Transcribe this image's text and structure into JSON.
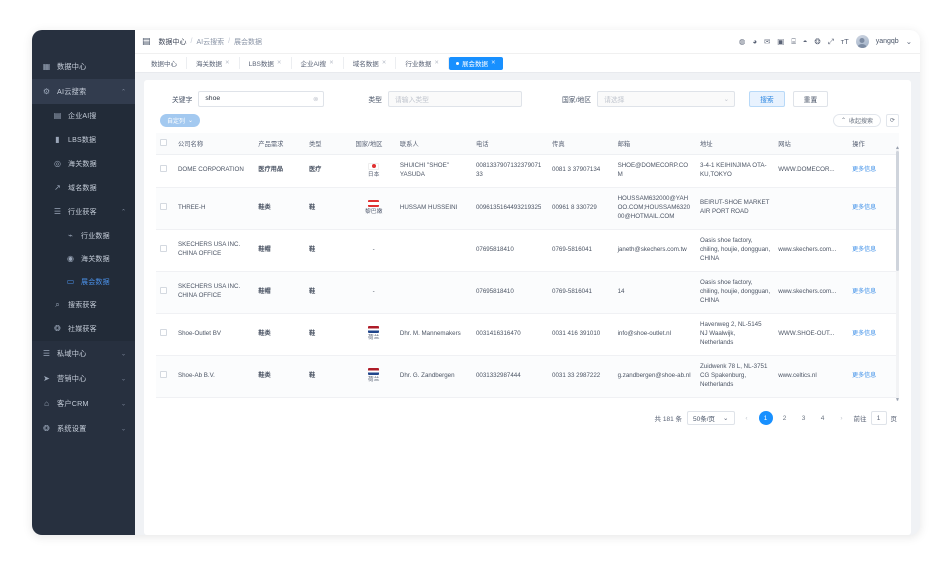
{
  "sidebar": {
    "items": [
      {
        "label": "数据中心",
        "icon": "grid-icon",
        "caret": ""
      },
      {
        "label": "AI云搜索",
        "icon": "gear-icon",
        "caret": "⌃"
      }
    ],
    "ai_children": [
      {
        "label": "企业AI搜",
        "icon": "building-icon"
      },
      {
        "label": "LBS数据",
        "icon": "book-icon"
      },
      {
        "label": "海关数据",
        "icon": "customs-icon"
      },
      {
        "label": "域名数据",
        "icon": "external-link-icon"
      }
    ],
    "industry": {
      "label": "行业获客",
      "icon": "list-icon",
      "caret": "⌃"
    },
    "industry_children": [
      {
        "label": "行业数据",
        "icon": "link-icon",
        "active": false
      },
      {
        "label": "海关数据",
        "icon": "target-icon",
        "active": false
      },
      {
        "label": "展会数据",
        "icon": "monitor-icon",
        "active": true
      }
    ],
    "after_industry": [
      {
        "label": "搜索获客",
        "icon": "search-icon"
      },
      {
        "label": "社媒获客",
        "icon": "globe-icon"
      }
    ],
    "bottom": [
      {
        "label": "私域中心",
        "icon": "layers-icon",
        "caret": "⌄"
      },
      {
        "label": "营销中心",
        "icon": "send-icon",
        "caret": "⌄"
      },
      {
        "label": "客户CRM",
        "icon": "car-icon",
        "caret": "⌄"
      },
      {
        "label": "系统设置",
        "icon": "globe-icon",
        "caret": "⌄"
      }
    ]
  },
  "topbar": {
    "hamburger": "menu-icon",
    "breadcrumb": [
      "数据中心",
      "AI云搜索",
      "展会数据"
    ],
    "icons": [
      "compass-icon",
      "message-icon",
      "mail-icon",
      "camera-icon",
      "screen-icon",
      "help-icon",
      "language-icon",
      "fullscreen-icon",
      "font-size-icon"
    ],
    "username": "yangqb",
    "user_caret": "⌄"
  },
  "tabs": [
    {
      "label": "数据中心",
      "closable": false,
      "active": false
    },
    {
      "label": "海关数据",
      "closable": true,
      "active": false
    },
    {
      "label": "LBS数据",
      "closable": true,
      "active": false
    },
    {
      "label": "企业AI搜",
      "closable": true,
      "active": false
    },
    {
      "label": "域名数据",
      "closable": true,
      "active": false
    },
    {
      "label": "行业数据",
      "closable": true,
      "active": false
    },
    {
      "label": "展会数据",
      "closable": true,
      "active": true
    }
  ],
  "filters": {
    "keyword_label": "关键字",
    "keyword_value": "shoe",
    "type_label": "类型",
    "type_placeholder": "请输入类型",
    "country_label": "国家/地区",
    "country_placeholder": "请选择",
    "search_button": "搜索",
    "reset_button": "重置",
    "column_button": "自定列",
    "column_caret": "⌄",
    "collapse_button": "收起搜索",
    "collapse_caret": "⌃",
    "refresh_icon": "refresh-icon"
  },
  "table": {
    "columns": [
      "公司名称",
      "产品需求",
      "类型",
      "国家/地区",
      "联系人",
      "电话",
      "传真",
      "邮箱",
      "地址",
      "网站",
      "操作"
    ],
    "action_label": "更多信息",
    "rows": [
      {
        "company": "DOME CORPORATION",
        "product": "医疗用品",
        "type": "医疗",
        "country": "日本",
        "flag": "#e03131",
        "contact": "SHUICHI \"SHOE\" YASUDA",
        "phone": "008133790713237907133",
        "fax": "0081 3 37907134",
        "email": "SHOE@DOMECORP.COM",
        "address": "3-4-1 KEIHINJIMA OTA-KU,TOKYO",
        "website": "WWW.DOMECOR..."
      },
      {
        "company": "THREE-H",
        "product": "鞋类",
        "type": "鞋",
        "country": "黎巴嫩",
        "flag": "#e03131",
        "contact": "HUSSAM HUSSEINI",
        "phone": "0096135164493219325",
        "fax": "00961 8 330729",
        "email": "HOUSSAM632000@YAHOO.COM;HOUSSAM632000@HOTMAIL.COM",
        "address": "BEIRUT-SHOE MARKET AIR PORT ROAD",
        "website": ""
      },
      {
        "company": "SKECHERS USA INC. CHINA OFFICE",
        "product": "鞋帽",
        "type": "鞋",
        "country": "-",
        "flag": "",
        "contact": "",
        "phone": "07695818410",
        "fax": "0769-5816041",
        "email": "janeth@skechers.com.tw",
        "address": "Oasis shoe factory, chiling, houjie, dongguan, CHINA",
        "website": "www.skechers.com..."
      },
      {
        "company": "SKECHERS USA INC. CHINA OFFICE",
        "product": "鞋帽",
        "type": "鞋",
        "country": "-",
        "flag": "",
        "contact": "",
        "phone": "07695818410",
        "fax": "0769-5816041",
        "email": "14",
        "address": "Oasis shoe factory, chiling, houjie, dongguan, CHINA",
        "website": "www.skechers.com..."
      },
      {
        "company": "Shoe-Outlet BV",
        "product": "鞋类",
        "type": "鞋",
        "country": "荷兰",
        "flag": "#ae1c28",
        "contact": "Dhr. M. Mannemakers",
        "phone": "0031416316470",
        "fax": "0031 416 391010",
        "email": "info@shoe-outlet.nl",
        "address": "Havenweg 2, NL-5145 NJ Waalwijk, Netherlands",
        "website": "WWW.SHOE-OUT..."
      },
      {
        "company": "Shoe-Ab B.V.",
        "product": "鞋类",
        "type": "鞋",
        "country": "荷兰",
        "flag": "#ae1c28",
        "contact": "Dhr. G. Zandbergen",
        "phone": "0031332987444",
        "fax": "0031 33 2987222",
        "email": "g.zandbergen@shoe-ab.nl",
        "address": "Zuidwenk 78 L, NL-3751 CG Spakenburg, Netherlands",
        "website": "www.celtics.nl"
      }
    ]
  },
  "pagination": {
    "total_text": "共 181 条",
    "page_size": "50条/页",
    "page_size_caret": "⌄",
    "prev": "‹",
    "next": "›",
    "pages": [
      "1",
      "2",
      "3",
      "4"
    ],
    "current": "1",
    "jump_prefix": "前往",
    "jump_value": "1",
    "jump_suffix": "页"
  },
  "colors": {
    "accent": "#1890ff",
    "sidebar": "#27303f",
    "link": "#3b8ee8"
  }
}
